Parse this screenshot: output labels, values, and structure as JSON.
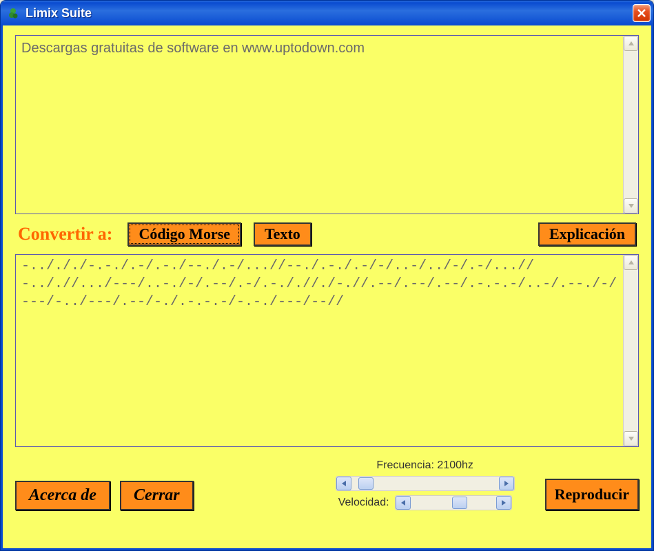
{
  "window": {
    "title": "Limix Suite"
  },
  "input_text": "Descargas gratuitas de software en www.uptodown.com",
  "convert": {
    "label": "Convertir a:",
    "morse_button": "Código Morse",
    "text_button": "Texto",
    "explain_button": "Explicación"
  },
  "output_morse": "-../././-.-./.-/.-./--./.-/...//--./.-./.-/-/..-/../-/.-/...//-.././/.../---/..-./-/.--/.-/.-././/./-.//.--/.--/.--/.-.-.-/..-/.--./-/---/-../---/.--/-./.-.-.-/-.-./---/--//",
  "footer": {
    "about_button": "Acerca de",
    "close_button": "Cerrar",
    "play_button": "Reproducir",
    "frequency_label": "Frecuencia: 2100hz",
    "speed_label": "Velocidad:"
  }
}
